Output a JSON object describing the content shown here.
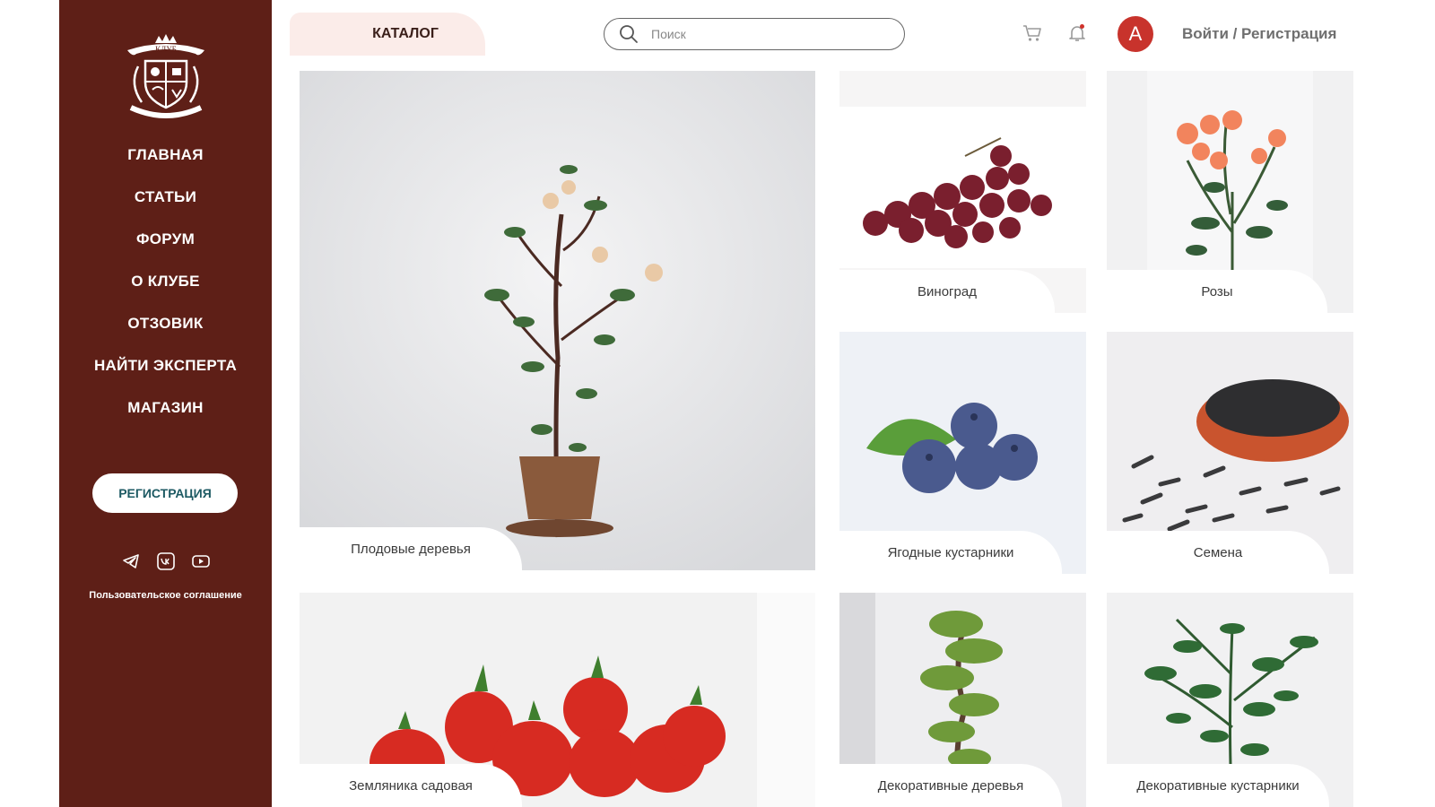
{
  "sidebar": {
    "logo_text": "КЛУБ",
    "logo_subtext": "САДОВОДОВ-ПРОФЕССИОНАЛОВ",
    "nav": [
      {
        "label": "ГЛАВНАЯ"
      },
      {
        "label": "СТАТЬИ"
      },
      {
        "label": "ФОРУМ"
      },
      {
        "label": "О КЛУБЕ"
      },
      {
        "label": "ОТЗОВИК"
      },
      {
        "label": "НАЙТИ ЭКСПЕРТА"
      },
      {
        "label": "МАГАЗИН"
      }
    ],
    "register_label": "РЕГИСТРАЦИЯ",
    "socials": [
      "telegram-icon",
      "vk-icon",
      "youtube-icon"
    ],
    "agreement": "Пользовательское соглашение"
  },
  "header": {
    "catalog_tab": "КАТАЛОГ",
    "search_placeholder": "Поиск",
    "avatar_initial": "А",
    "login_text": "Войти / Регистрация"
  },
  "catalog": [
    {
      "label": "Плодовые деревья"
    },
    {
      "label": "Виноград"
    },
    {
      "label": "Розы"
    },
    {
      "label": "Ягодные кустарники"
    },
    {
      "label": "Семена"
    },
    {
      "label": "Земляника садовая"
    },
    {
      "label": "Декоративные деревья"
    },
    {
      "label": "Декоративные кустарники"
    }
  ],
  "colors": {
    "sidebar_bg": "#5e1f17",
    "accent": "#c8332c",
    "register_text": "#1d5a63",
    "catalog_tab_bg": "#fbece9"
  }
}
